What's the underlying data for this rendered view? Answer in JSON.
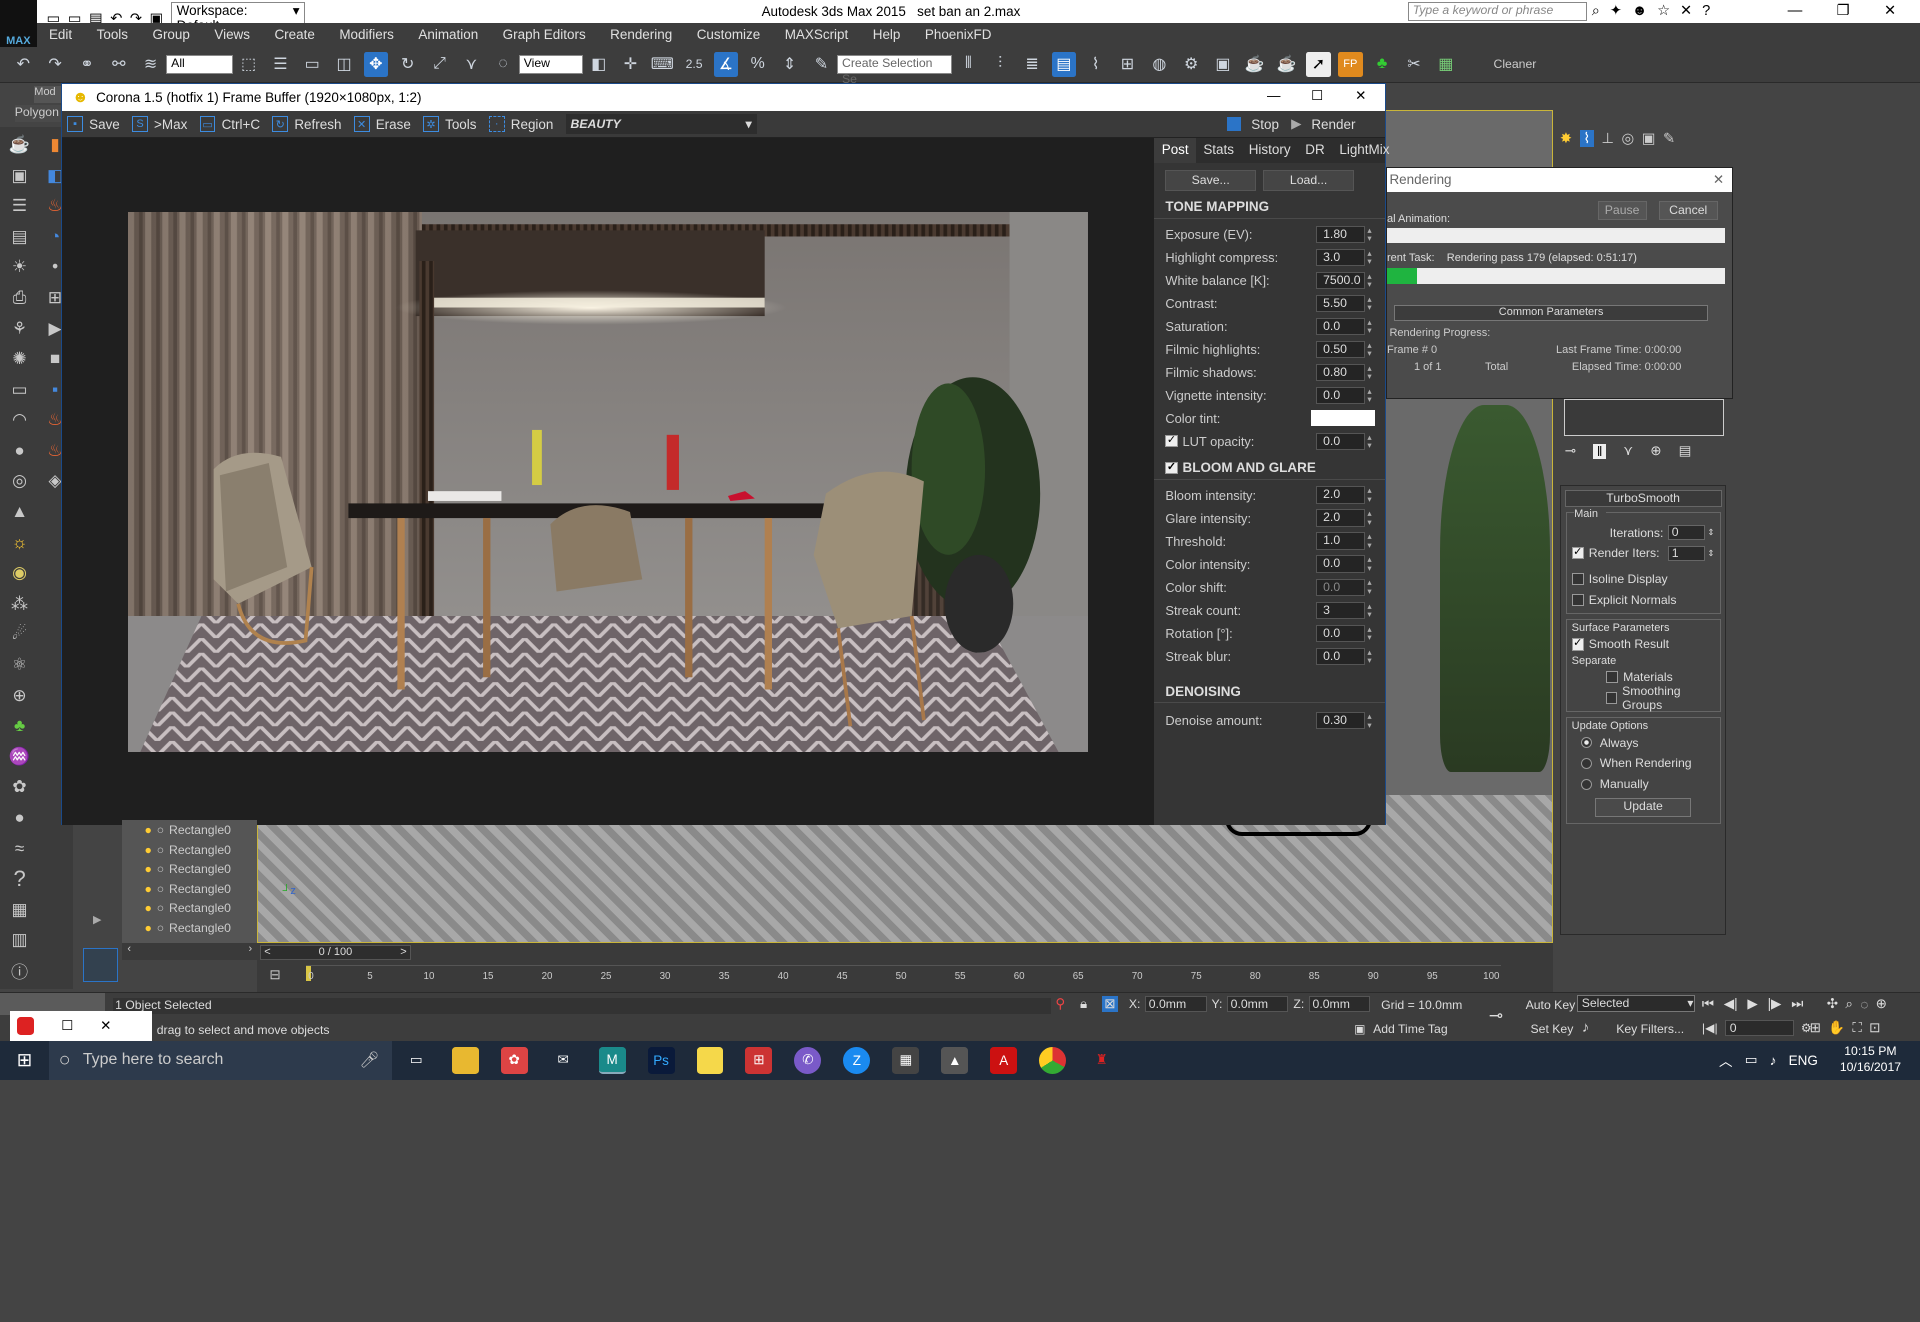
{
  "window": {
    "app_title": "Autodesk 3ds Max  2015",
    "file": "set ban an 2.max",
    "workspace": "Workspace: Default",
    "search_placeholder": "Type a keyword or phrase"
  },
  "menu": [
    "Edit",
    "Tools",
    "Group",
    "Views",
    "Create",
    "Modifiers",
    "Animation",
    "Graph Editors",
    "Rendering",
    "Customize",
    "MAXScript",
    "Help",
    "PhoenixFD"
  ],
  "toolbar": {
    "filter": "All",
    "view": "View",
    "selection_set": "Create Selection Se",
    "snap": "2.5",
    "cleaner": "Cleaner"
  },
  "left_tabs": {
    "mod": "Mod",
    "polygon": "Polygon"
  },
  "fb": {
    "title": "Corona 1.5 (hotfix 1) Frame Buffer (1920×1080px, 1:2)",
    "tools": [
      {
        "label": "Save",
        "icon": "save-icon"
      },
      {
        "label": ">Max",
        "icon": "max-icon"
      },
      {
        "label": "Ctrl+C",
        "icon": "copy-icon"
      },
      {
        "label": "Refresh",
        "icon": "refresh-icon"
      },
      {
        "label": "Erase",
        "icon": "erase-icon"
      },
      {
        "label": "Tools",
        "icon": "gear-icon"
      },
      {
        "label": "Region",
        "icon": "region-icon"
      }
    ],
    "channel": "BEAUTY",
    "stop": "Stop",
    "render": "Render",
    "tabs": [
      "Post",
      "Stats",
      "History",
      "DR",
      "LightMix"
    ],
    "save_btn": "Save...",
    "load_btn": "Load...",
    "tone_header": "TONE MAPPING",
    "tone": [
      {
        "label": "Exposure (EV):",
        "value": "1.80"
      },
      {
        "label": "Highlight compress:",
        "value": "3.0"
      },
      {
        "label": "White balance [K]:",
        "value": "7500.0"
      },
      {
        "label": "Contrast:",
        "value": "5.50"
      },
      {
        "label": "Saturation:",
        "value": "0.0"
      },
      {
        "label": "Filmic highlights:",
        "value": "0.50"
      },
      {
        "label": "Filmic shadows:",
        "value": "0.80"
      },
      {
        "label": "Vignette intensity:",
        "value": "0.0"
      }
    ],
    "color_tint": "Color tint:",
    "lut": "LUT opacity:",
    "lut_value": "0.0",
    "bloom_header": "BLOOM AND GLARE",
    "bloom": [
      {
        "label": "Bloom intensity:",
        "value": "2.0"
      },
      {
        "label": "Glare intensity:",
        "value": "2.0"
      },
      {
        "label": "Threshold:",
        "value": "1.0"
      },
      {
        "label": "Color intensity:",
        "value": "0.0"
      },
      {
        "label": "Color shift:",
        "value": "0.0"
      },
      {
        "label": "Streak count:",
        "value": "3"
      },
      {
        "label": "Rotation [°]:",
        "value": "0.0"
      },
      {
        "label": "Streak blur:",
        "value": "0.0"
      }
    ],
    "denoise_header": "DENOISING",
    "denoise_label": "Denoise amount:",
    "denoise_value": "0.30"
  },
  "rendering": {
    "title": "Rendering",
    "pause": "Pause",
    "cancel": "Cancel",
    "total_anim": "al Animation:",
    "cur_task": "rent Task:",
    "task_text": "Rendering pass 179 (elapsed: 0:51:17)",
    "progress": 0.09,
    "common": "Common Parameters",
    "progress_label": "Rendering Progress:",
    "frame_label": "Frame #",
    "frame_val": "0",
    "of": "1 of 1",
    "total": "Total",
    "last_frame": "Last Frame Time: 0:00:00",
    "elapsed": "Elapsed Time: 0:00:00"
  },
  "turbosmooth": {
    "title": "TurboSmooth",
    "main": "Main",
    "iterations": "Iterations:",
    "iter_val": "0",
    "render_iters": "Render Iters:",
    "render_val": "1",
    "isoline": "Isoline Display",
    "explicit": "Explicit Normals",
    "surface": "Surface Parameters",
    "smooth": "Smooth Result",
    "separate": "Separate",
    "materials": "Materials",
    "smoothing": "Smoothing Groups",
    "update_opts": "Update Options",
    "always": "Always",
    "when_rendering": "When Rendering",
    "manually": "Manually",
    "update": "Update"
  },
  "scene_items": [
    "Rectangle0",
    "Rectangle0",
    "Rectangle0",
    "Rectangle0",
    "Rectangle0",
    "Rectangle0"
  ],
  "timeline": {
    "frame": "0 / 100",
    "ticks": [
      "0",
      "5",
      "10",
      "15",
      "20",
      "25",
      "30",
      "35",
      "40",
      "45",
      "50",
      "55",
      "60",
      "65",
      "70",
      "75",
      "80",
      "85",
      "90",
      "95",
      "100"
    ]
  },
  "status": {
    "selected": "1 Object Selected",
    "hint": "drag to select and move objects",
    "x": "0.0mm",
    "y": "0.0mm",
    "z": "0.0mm",
    "grid": "Grid = 10.0mm",
    "add_time_tag": "Add Time Tag",
    "auto_key": "Auto Key",
    "set_key": "Set Key",
    "selected_dd": "Selected",
    "key_filters": "Key Filters...",
    "frame_box": "0"
  },
  "taskbar": {
    "search": "Type here to search",
    "lang": "ENG",
    "time": "10:15 PM",
    "date": "10/16/2017"
  }
}
